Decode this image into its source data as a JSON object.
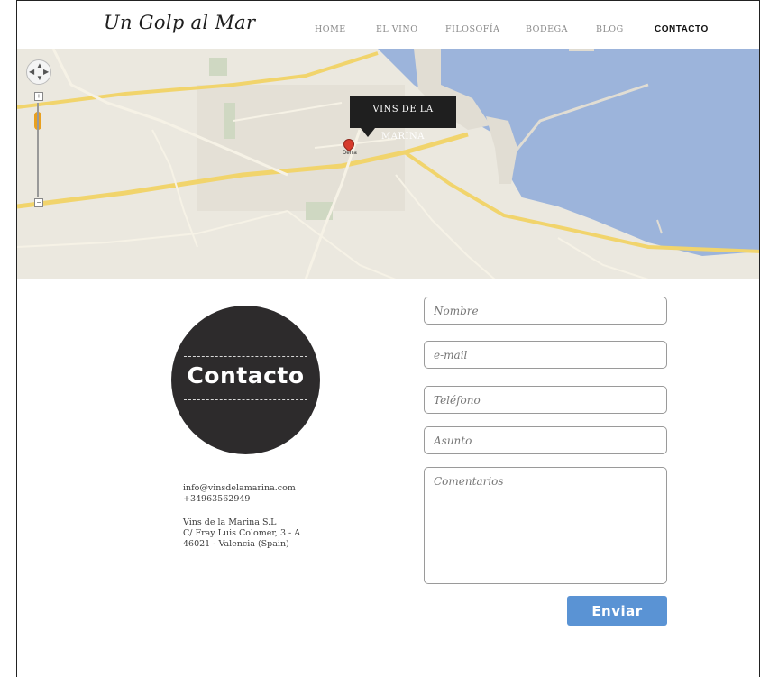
{
  "header": {
    "logo": "Un Golp al Mar",
    "nav": [
      {
        "label": "HOME"
      },
      {
        "label": "EL VINO"
      },
      {
        "label": "FILOSOFÍA"
      },
      {
        "label": "BODEGA"
      },
      {
        "label": "BLOG"
      },
      {
        "label": "CONTACTO",
        "active": true
      }
    ]
  },
  "map": {
    "marker_label": "VINS DE LA MARINA",
    "pin_label": "Dénia"
  },
  "contact": {
    "title": "Contacto",
    "email": "info@vinsdelamarina.com",
    "phone": "+34963562949",
    "company": "Vins de la Marina S.L",
    "street": "C/ Fray Luis Colomer, 3 - A",
    "city": "46021 - Valencia (Spain)"
  },
  "form": {
    "name_placeholder": "Nombre",
    "email_placeholder": "e-mail",
    "phone_placeholder": "Teléfono",
    "subject_placeholder": "Asunto",
    "comments_placeholder": "Comentarios",
    "submit_label": "Enviar"
  },
  "colors": {
    "accent": "#5a93d4",
    "circle": "#2d2b2c",
    "water": "#9cb4db"
  }
}
